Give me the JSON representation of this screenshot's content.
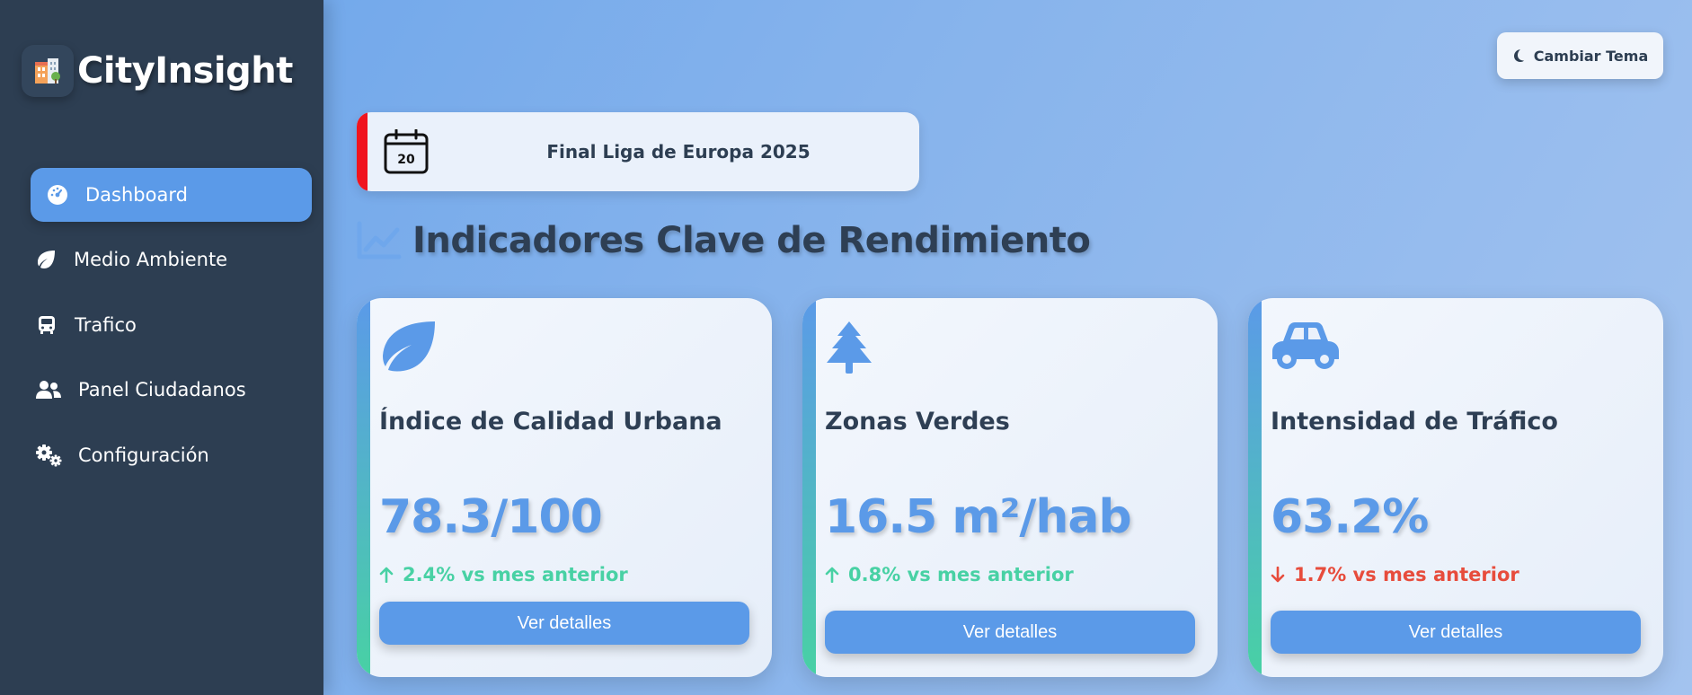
{
  "brand": {
    "name": "CityInsight",
    "logo_icon": "city-building-icon"
  },
  "sidebar": {
    "items": [
      {
        "label": "Dashboard",
        "icon": "gauge-icon",
        "active": true
      },
      {
        "label": "Medio Ambiente",
        "icon": "leaf-icon",
        "active": false
      },
      {
        "label": "Trafico",
        "icon": "bus-icon",
        "active": false
      },
      {
        "label": "Panel Ciudadanos",
        "icon": "users-icon",
        "active": false
      },
      {
        "label": "Configuración",
        "icon": "cogs-icon",
        "active": false
      }
    ]
  },
  "header": {
    "theme_button": "Cambiar Tema",
    "theme_icon": "moon-icon"
  },
  "event": {
    "day": "20",
    "title": "Final Liga de Europa 2025",
    "stripe_color": "#f0141e",
    "icon": "calendar-icon"
  },
  "kpi_section": {
    "title": "Indicadores Clave de Rendimiento",
    "icon": "line-chart-icon"
  },
  "cards": [
    {
      "icon": "leaf-icon",
      "title": "Índice de Calidad Urbana",
      "value": "78.3/100",
      "change": "2.4% vs mes anterior",
      "trend": "up",
      "button": "Ver detalles"
    },
    {
      "icon": "tree-icon",
      "title": "Zonas Verdes",
      "value": "16.5 m²/hab",
      "change": "0.8% vs mes anterior",
      "trend": "up",
      "button": "Ver detalles"
    },
    {
      "icon": "car-icon",
      "title": "Intensidad de Tráfico",
      "value": "63.2%",
      "change": "1.7% vs mes anterior",
      "trend": "down",
      "button": "Ver detalles"
    }
  ],
  "colors": {
    "accent": "#5b9ae8",
    "sidebar": "#2d3e52",
    "positive": "#48d1a4",
    "negative": "#e74c3c"
  }
}
